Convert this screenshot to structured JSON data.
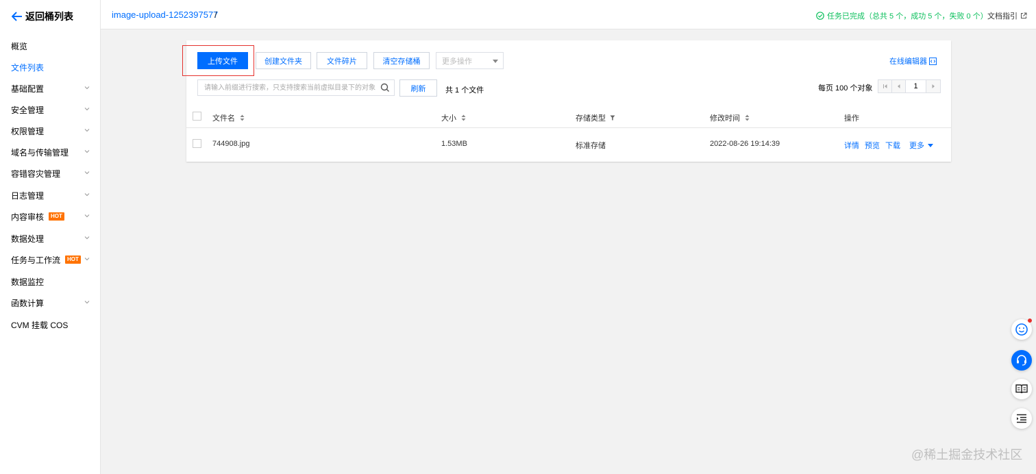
{
  "sidebar": {
    "back_label": "返回桶列表",
    "items": [
      {
        "label": "概览",
        "expandable": false,
        "hot": false,
        "active": false
      },
      {
        "label": "文件列表",
        "expandable": false,
        "hot": false,
        "active": true
      },
      {
        "label": "基础配置",
        "expandable": true,
        "hot": false,
        "active": false
      },
      {
        "label": "安全管理",
        "expandable": true,
        "hot": false,
        "active": false
      },
      {
        "label": "权限管理",
        "expandable": true,
        "hot": false,
        "active": false
      },
      {
        "label": "域名与传输管理",
        "expandable": true,
        "hot": false,
        "active": false
      },
      {
        "label": "容错容灾管理",
        "expandable": true,
        "hot": false,
        "active": false
      },
      {
        "label": "日志管理",
        "expandable": true,
        "hot": false,
        "active": false
      },
      {
        "label": "内容审核",
        "expandable": true,
        "hot": true,
        "active": false
      },
      {
        "label": "数据处理",
        "expandable": true,
        "hot": false,
        "active": false
      },
      {
        "label": "任务与工作流",
        "expandable": true,
        "hot": true,
        "active": false
      },
      {
        "label": "数据监控",
        "expandable": false,
        "hot": false,
        "active": false
      },
      {
        "label": "函数计算",
        "expandable": true,
        "hot": false,
        "active": false
      },
      {
        "label": "CVM 挂载 COS",
        "expandable": false,
        "hot": false,
        "active": false
      }
    ],
    "hot_label": "HOT"
  },
  "header": {
    "bucket_name": "image-upload-1252397577",
    "separator": "/",
    "task_status": "任务已完成（总共 5 个，成功 5 个，失败 0 个）",
    "doc_link": "文档指引"
  },
  "toolbar": {
    "upload": "上传文件",
    "create_folder": "创建文件夹",
    "fragments": "文件碎片",
    "clear_bucket": "清空存储桶",
    "more_ops_placeholder": "更多操作",
    "online_editor": "在线编辑器"
  },
  "search": {
    "placeholder": "请输入前缀进行搜索，只支持搜索当前虚拟目录下的对象",
    "refresh": "刷新",
    "total": "共 1 个文件"
  },
  "pagination": {
    "per_page": "每页 100 个对象",
    "current_page": "1"
  },
  "table": {
    "columns": {
      "name": "文件名",
      "size": "大小",
      "storage": "存储类型",
      "modified": "修改时间",
      "actions": "操作"
    },
    "rows": [
      {
        "name": "744908.jpg",
        "size": "1.53MB",
        "storage": "标准存储",
        "modified": "2022-08-26 19:14:39",
        "actions": [
          "详情",
          "预览",
          "下载",
          "更多"
        ]
      }
    ]
  },
  "watermark": "@稀土掘金技术社区",
  "colors": {
    "accent": "#006eff",
    "success": "#0abf5b",
    "hot": "#ff7200",
    "highlight_border": "#e5312d"
  }
}
